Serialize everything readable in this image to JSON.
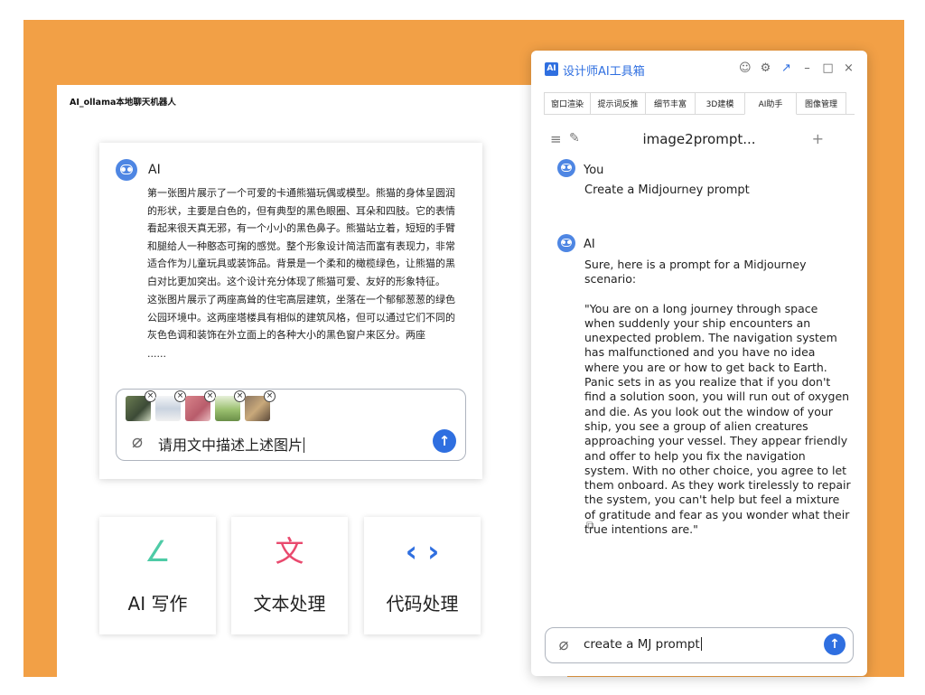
{
  "app": {
    "title": "AI_ollama本地聊天机器人"
  },
  "chat": {
    "ai_name": "AI",
    "paragraph_1": "第一张图片展示了一个可爱的卡通熊猫玩偶或模型。熊猫的身体呈圆润的形状，主要是白色的，但有典型的黑色眼圈、耳朵和四肢。它的表情看起来很天真无邪，有一个小小的黑色鼻子。熊猫站立着，短短的手臂和腿给人一种憨态可掬的感觉。整个形象设计简洁而富有表现力，非常适合作为儿童玩具或装饰品。背景是一个柔和的橄榄绿色，让熊猫的黑白对比更加突出。这个设计充分体现了熊猫可爱、友好的形象特征。",
    "paragraph_2": "这张图片展示了两座高耸的住宅高层建筑，坐落在一个郁郁葱葱的绿色公园环境中。这两座塔楼具有相似的建筑风格，但可以通过它们不同的灰色色调和装饰在外立面上的各种大小的黑色窗户来区分。两座",
    "ellipsis": "......",
    "input_value": "请用文中描述上述图片"
  },
  "tools": [
    {
      "label": "AI 写作",
      "icon": "∠"
    },
    {
      "label": "文本处理",
      "icon": "文"
    },
    {
      "label": "代码处理",
      "icon": "‹ ›"
    }
  ],
  "assistant": {
    "logo": "AI",
    "title": "设计师AI工具箱",
    "tabs": [
      "窗口渲染",
      "提示词反推",
      "细节丰富",
      "3D建模",
      "AI助手",
      "图像管理"
    ],
    "active_tab": "AI助手",
    "conversation_title": "image2prompt...",
    "user_name": "You",
    "user_message": "Create a Midjourney prompt",
    "ai_name": "AI",
    "ai_intro": "Sure, here is a prompt for a Midjourney scenario:",
    "ai_prompt": "\"You are on a long journey through space when suddenly your ship encounters an unexpected problem. The navigation system has malfunctioned and you have no idea where you are or how to get back to Earth. Panic sets in as you realize that if you don't find a solution soon, you will run out of oxygen and die. As you look out the window of your ship, you see a group of alien creatures approaching your vessel. They appear friendly and offer to help you fix the navigation system. With no other choice, you agree to let them onboard. As they work tirelessly to repair the system, you can't help but feel a mixture of gratitude and fear as you wonder what their true intentions are.\"",
    "input_value": "create a MJ prompt"
  }
}
